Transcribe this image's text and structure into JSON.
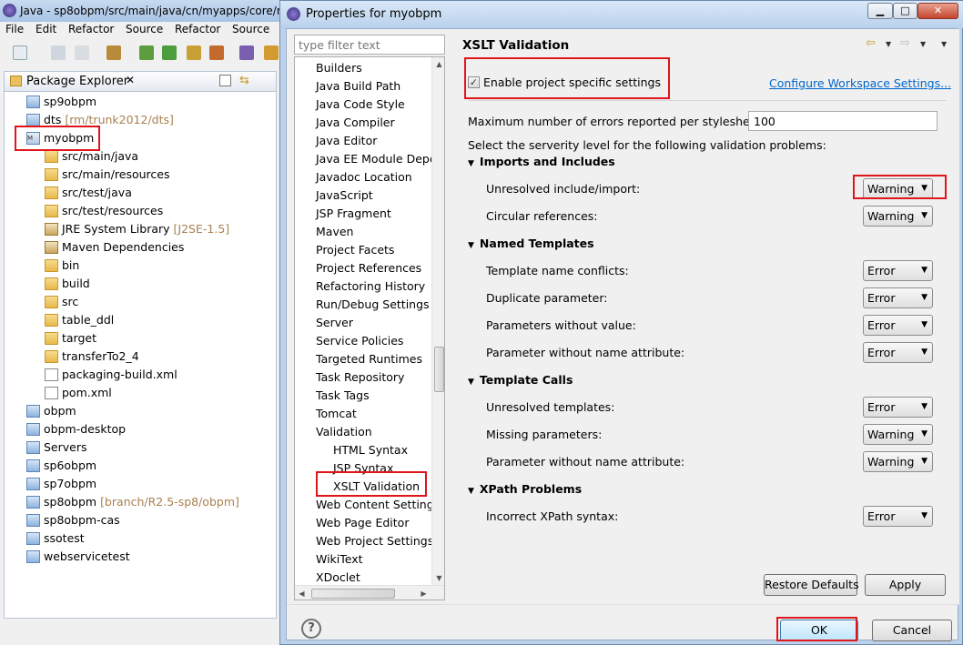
{
  "eclipse": {
    "title": "Java - sp8obpm/src/main/java/cn/myapps/core/r",
    "menu": [
      "File",
      "Edit",
      "Refactor",
      "Source",
      "Refactor",
      "Source"
    ],
    "view_title": "Package Explorer",
    "tree": [
      {
        "label": "sp9obpm",
        "decoration": "",
        "icon": "project-icon"
      },
      {
        "label": "dts",
        "decoration": "[rm/trunk2012/dts]",
        "icon": "project-icon"
      },
      {
        "label": "myobpm",
        "decoration": "",
        "icon": "maven-project-icon"
      },
      {
        "label": "src/main/java",
        "decoration": "",
        "icon": "source-folder-icon"
      },
      {
        "label": "src/main/resources",
        "decoration": "",
        "icon": "source-folder-icon"
      },
      {
        "label": "src/test/java",
        "decoration": "",
        "icon": "source-folder-icon"
      },
      {
        "label": "src/test/resources",
        "decoration": "",
        "icon": "source-folder-icon"
      },
      {
        "label": "JRE System Library",
        "decoration": "[J2SE-1.5]",
        "icon": "library-icon"
      },
      {
        "label": "Maven Dependencies",
        "decoration": "",
        "icon": "library-icon"
      },
      {
        "label": "bin",
        "decoration": "",
        "icon": "folder-icon"
      },
      {
        "label": "build",
        "decoration": "",
        "icon": "folder-icon"
      },
      {
        "label": "src",
        "decoration": "",
        "icon": "folder-icon"
      },
      {
        "label": "table_ddl",
        "decoration": "",
        "icon": "folder-icon"
      },
      {
        "label": "target",
        "decoration": "",
        "icon": "folder-icon"
      },
      {
        "label": "transferTo2_4",
        "decoration": "",
        "icon": "folder-icon"
      },
      {
        "label": "packaging-build.xml",
        "decoration": "",
        "icon": "xml-file-icon"
      },
      {
        "label": "pom.xml",
        "decoration": "",
        "icon": "xml-file-icon"
      },
      {
        "label": "obpm",
        "decoration": "",
        "icon": "project-icon"
      },
      {
        "label": "obpm-desktop",
        "decoration": "",
        "icon": "project-icon"
      },
      {
        "label": "Servers",
        "decoration": "",
        "icon": "project-icon"
      },
      {
        "label": "sp6obpm",
        "decoration": "",
        "icon": "project-icon"
      },
      {
        "label": "sp7obpm",
        "decoration": "",
        "icon": "project-icon"
      },
      {
        "label": "sp8obpm",
        "decoration": "[branch/R2.5-sp8/obpm]",
        "icon": "project-icon"
      },
      {
        "label": "sp8obpm-cas",
        "decoration": "",
        "icon": "project-icon"
      },
      {
        "label": "ssotest",
        "decoration": "",
        "icon": "project-icon"
      },
      {
        "label": "webservicetest",
        "decoration": "",
        "icon": "project-icon"
      }
    ]
  },
  "dialog": {
    "title": "Properties for myobpm",
    "filter_placeholder": "type filter text",
    "nav_items": [
      {
        "label": "Builders",
        "level": 0
      },
      {
        "label": "Java Build Path",
        "level": 0
      },
      {
        "label": "Java Code Style",
        "level": 0
      },
      {
        "label": "Java Compiler",
        "level": 0
      },
      {
        "label": "Java Editor",
        "level": 0
      },
      {
        "label": "Java EE Module Depe",
        "level": 0
      },
      {
        "label": "Javadoc Location",
        "level": 0
      },
      {
        "label": "JavaScript",
        "level": 0
      },
      {
        "label": "JSP Fragment",
        "level": 0
      },
      {
        "label": "Maven",
        "level": 0
      },
      {
        "label": "Project Facets",
        "level": 0
      },
      {
        "label": "Project References",
        "level": 0
      },
      {
        "label": "Refactoring History",
        "level": 0
      },
      {
        "label": "Run/Debug Settings",
        "level": 0
      },
      {
        "label": "Server",
        "level": 0
      },
      {
        "label": "Service Policies",
        "level": 0
      },
      {
        "label": "Targeted Runtimes",
        "level": 0
      },
      {
        "label": "Task Repository",
        "level": 0
      },
      {
        "label": "Task Tags",
        "level": 0
      },
      {
        "label": "Tomcat",
        "level": 0
      },
      {
        "label": "Validation",
        "level": 0
      },
      {
        "label": "HTML Syntax",
        "level": 1
      },
      {
        "label": "JSP Syntax",
        "level": 1
      },
      {
        "label": "XSLT Validation",
        "level": 1
      },
      {
        "label": "Web Content Settings",
        "level": 0
      },
      {
        "label": "Web Page Editor",
        "level": 0
      },
      {
        "label": "Web Project Settings",
        "level": 0
      },
      {
        "label": "WikiText",
        "level": 0
      },
      {
        "label": "XDoclet",
        "level": 0
      }
    ],
    "page": {
      "title": "XSLT Validation",
      "enable_label": "Enable project specific settings",
      "enable_checked": true,
      "config_link": "Configure Workspace Settings...",
      "max_errors_label": "Maximum number of errors reported per stylesheet:",
      "max_errors_value": "100",
      "severity_intro": "Select the serverity level for the following validation problems:",
      "sections": [
        {
          "title": "Imports and Includes",
          "rows": [
            {
              "label": "Unresolved include/import:",
              "value": "Warning"
            },
            {
              "label": "Circular references:",
              "value": "Warning"
            }
          ]
        },
        {
          "title": "Named Templates",
          "rows": [
            {
              "label": "Template name conflicts:",
              "value": "Error"
            },
            {
              "label": "Duplicate parameter:",
              "value": "Error"
            },
            {
              "label": "Parameters without value:",
              "value": "Error"
            },
            {
              "label": "Parameter without name attribute:",
              "value": "Error"
            }
          ]
        },
        {
          "title": "Template Calls",
          "rows": [
            {
              "label": "Unresolved templates:",
              "value": "Error"
            },
            {
              "label": "Missing parameters:",
              "value": "Warning"
            },
            {
              "label": "Parameter without name attribute:",
              "value": "Warning"
            }
          ]
        },
        {
          "title": "XPath Problems",
          "rows": [
            {
              "label": "Incorrect XPath syntax:",
              "value": "Error"
            }
          ]
        }
      ],
      "restore_defaults": "Restore Defaults",
      "apply": "Apply"
    },
    "ok": "OK",
    "cancel": "Cancel",
    "help": "?"
  },
  "colors": {
    "highlight": "#e0141b",
    "link": "#0066cc",
    "decoration": "#a88150"
  }
}
